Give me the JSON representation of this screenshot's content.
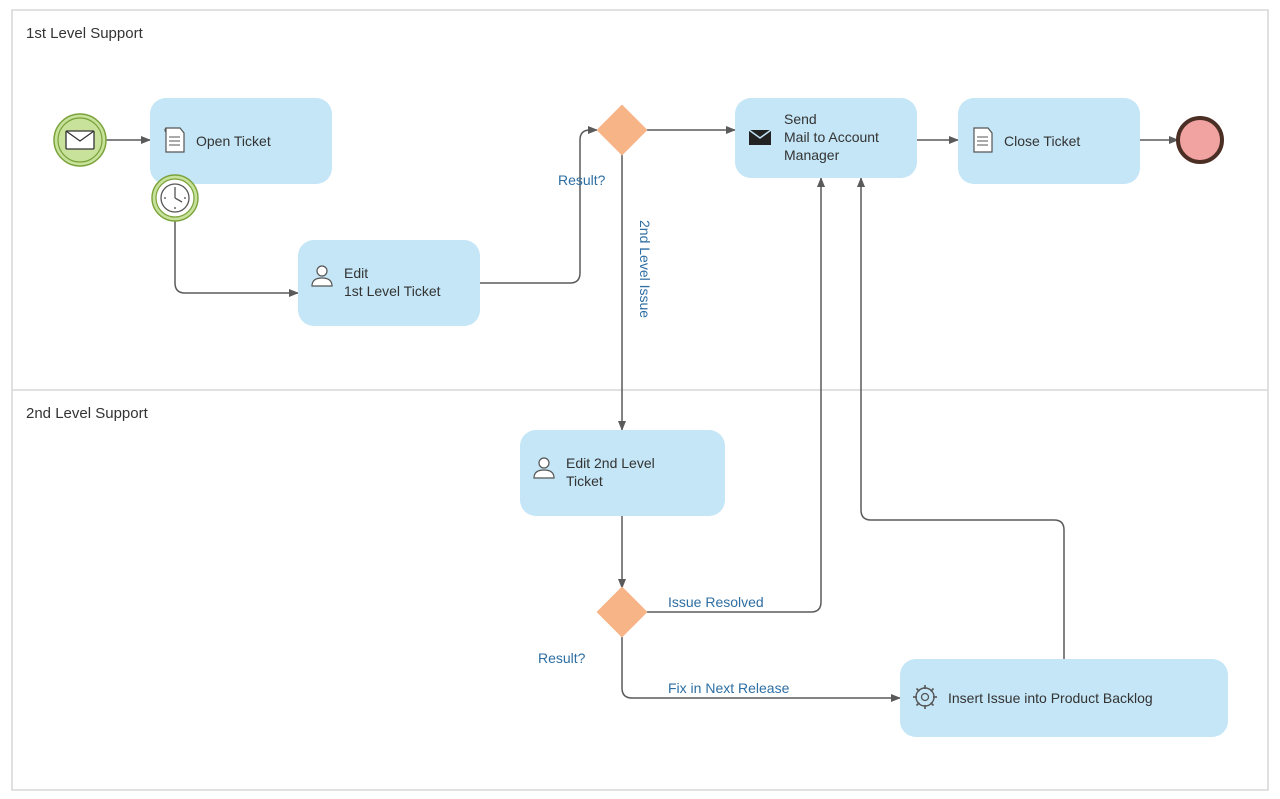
{
  "diagram": {
    "type": "bpmn",
    "lanes": [
      {
        "id": "lane1",
        "title": "1st Level Support"
      },
      {
        "id": "lane2",
        "title": "2nd Level Support"
      }
    ],
    "nodes": {
      "start": {
        "kind": "message-start-event",
        "lane": "lane1"
      },
      "openTicket": {
        "kind": "user-task",
        "label": "Open Ticket",
        "lane": "lane1"
      },
      "timer": {
        "kind": "timer-boundary-event",
        "attachedTo": "openTicket"
      },
      "edit1st": {
        "kind": "user-task",
        "label_line1": "Edit",
        "label_line2": "1st Level Ticket",
        "lane": "lane1"
      },
      "gateway1": {
        "kind": "exclusive-gateway",
        "label": "Result?",
        "lane": "lane1"
      },
      "sendMail": {
        "kind": "send-task",
        "label_line1": "Send",
        "label_line2": "Mail to Account",
        "label_line3": "Manager",
        "lane": "lane1"
      },
      "closeTicket": {
        "kind": "user-task",
        "label": "Close Ticket",
        "lane": "lane1"
      },
      "end": {
        "kind": "end-event",
        "lane": "lane1"
      },
      "edit2nd": {
        "kind": "user-task",
        "label_line1": "Edit 2nd Level",
        "label_line2": "Ticket",
        "lane": "lane2"
      },
      "gateway2": {
        "kind": "exclusive-gateway",
        "label": "Result?",
        "lane": "lane2"
      },
      "insertBacklog": {
        "kind": "service-task",
        "label": "Insert Issue into Product Backlog",
        "lane": "lane2"
      }
    },
    "flows": [
      {
        "from": "start",
        "to": "openTicket"
      },
      {
        "from": "timer",
        "to": "edit1st"
      },
      {
        "from": "edit1st",
        "to": "gateway1"
      },
      {
        "from": "gateway1",
        "to": "sendMail"
      },
      {
        "from": "gateway1",
        "to": "edit2nd",
        "label": "2nd Level Issue"
      },
      {
        "from": "sendMail",
        "to": "closeTicket"
      },
      {
        "from": "closeTicket",
        "to": "end"
      },
      {
        "from": "edit2nd",
        "to": "gateway2"
      },
      {
        "from": "gateway2",
        "to": "sendMail",
        "label": "Issue Resolved"
      },
      {
        "from": "gateway2",
        "to": "insertBacklog",
        "label": "Fix in Next Release"
      },
      {
        "from": "insertBacklog",
        "to": "sendMail"
      }
    ],
    "colors": {
      "task_fill": "#c4e6f6",
      "gateway_fill": "#f7b487",
      "event_fill": "#c8e29c",
      "end_fill": "#f1a3a2",
      "lane_border": "#d7d7d7",
      "arrow": "#5a5a5a"
    }
  }
}
